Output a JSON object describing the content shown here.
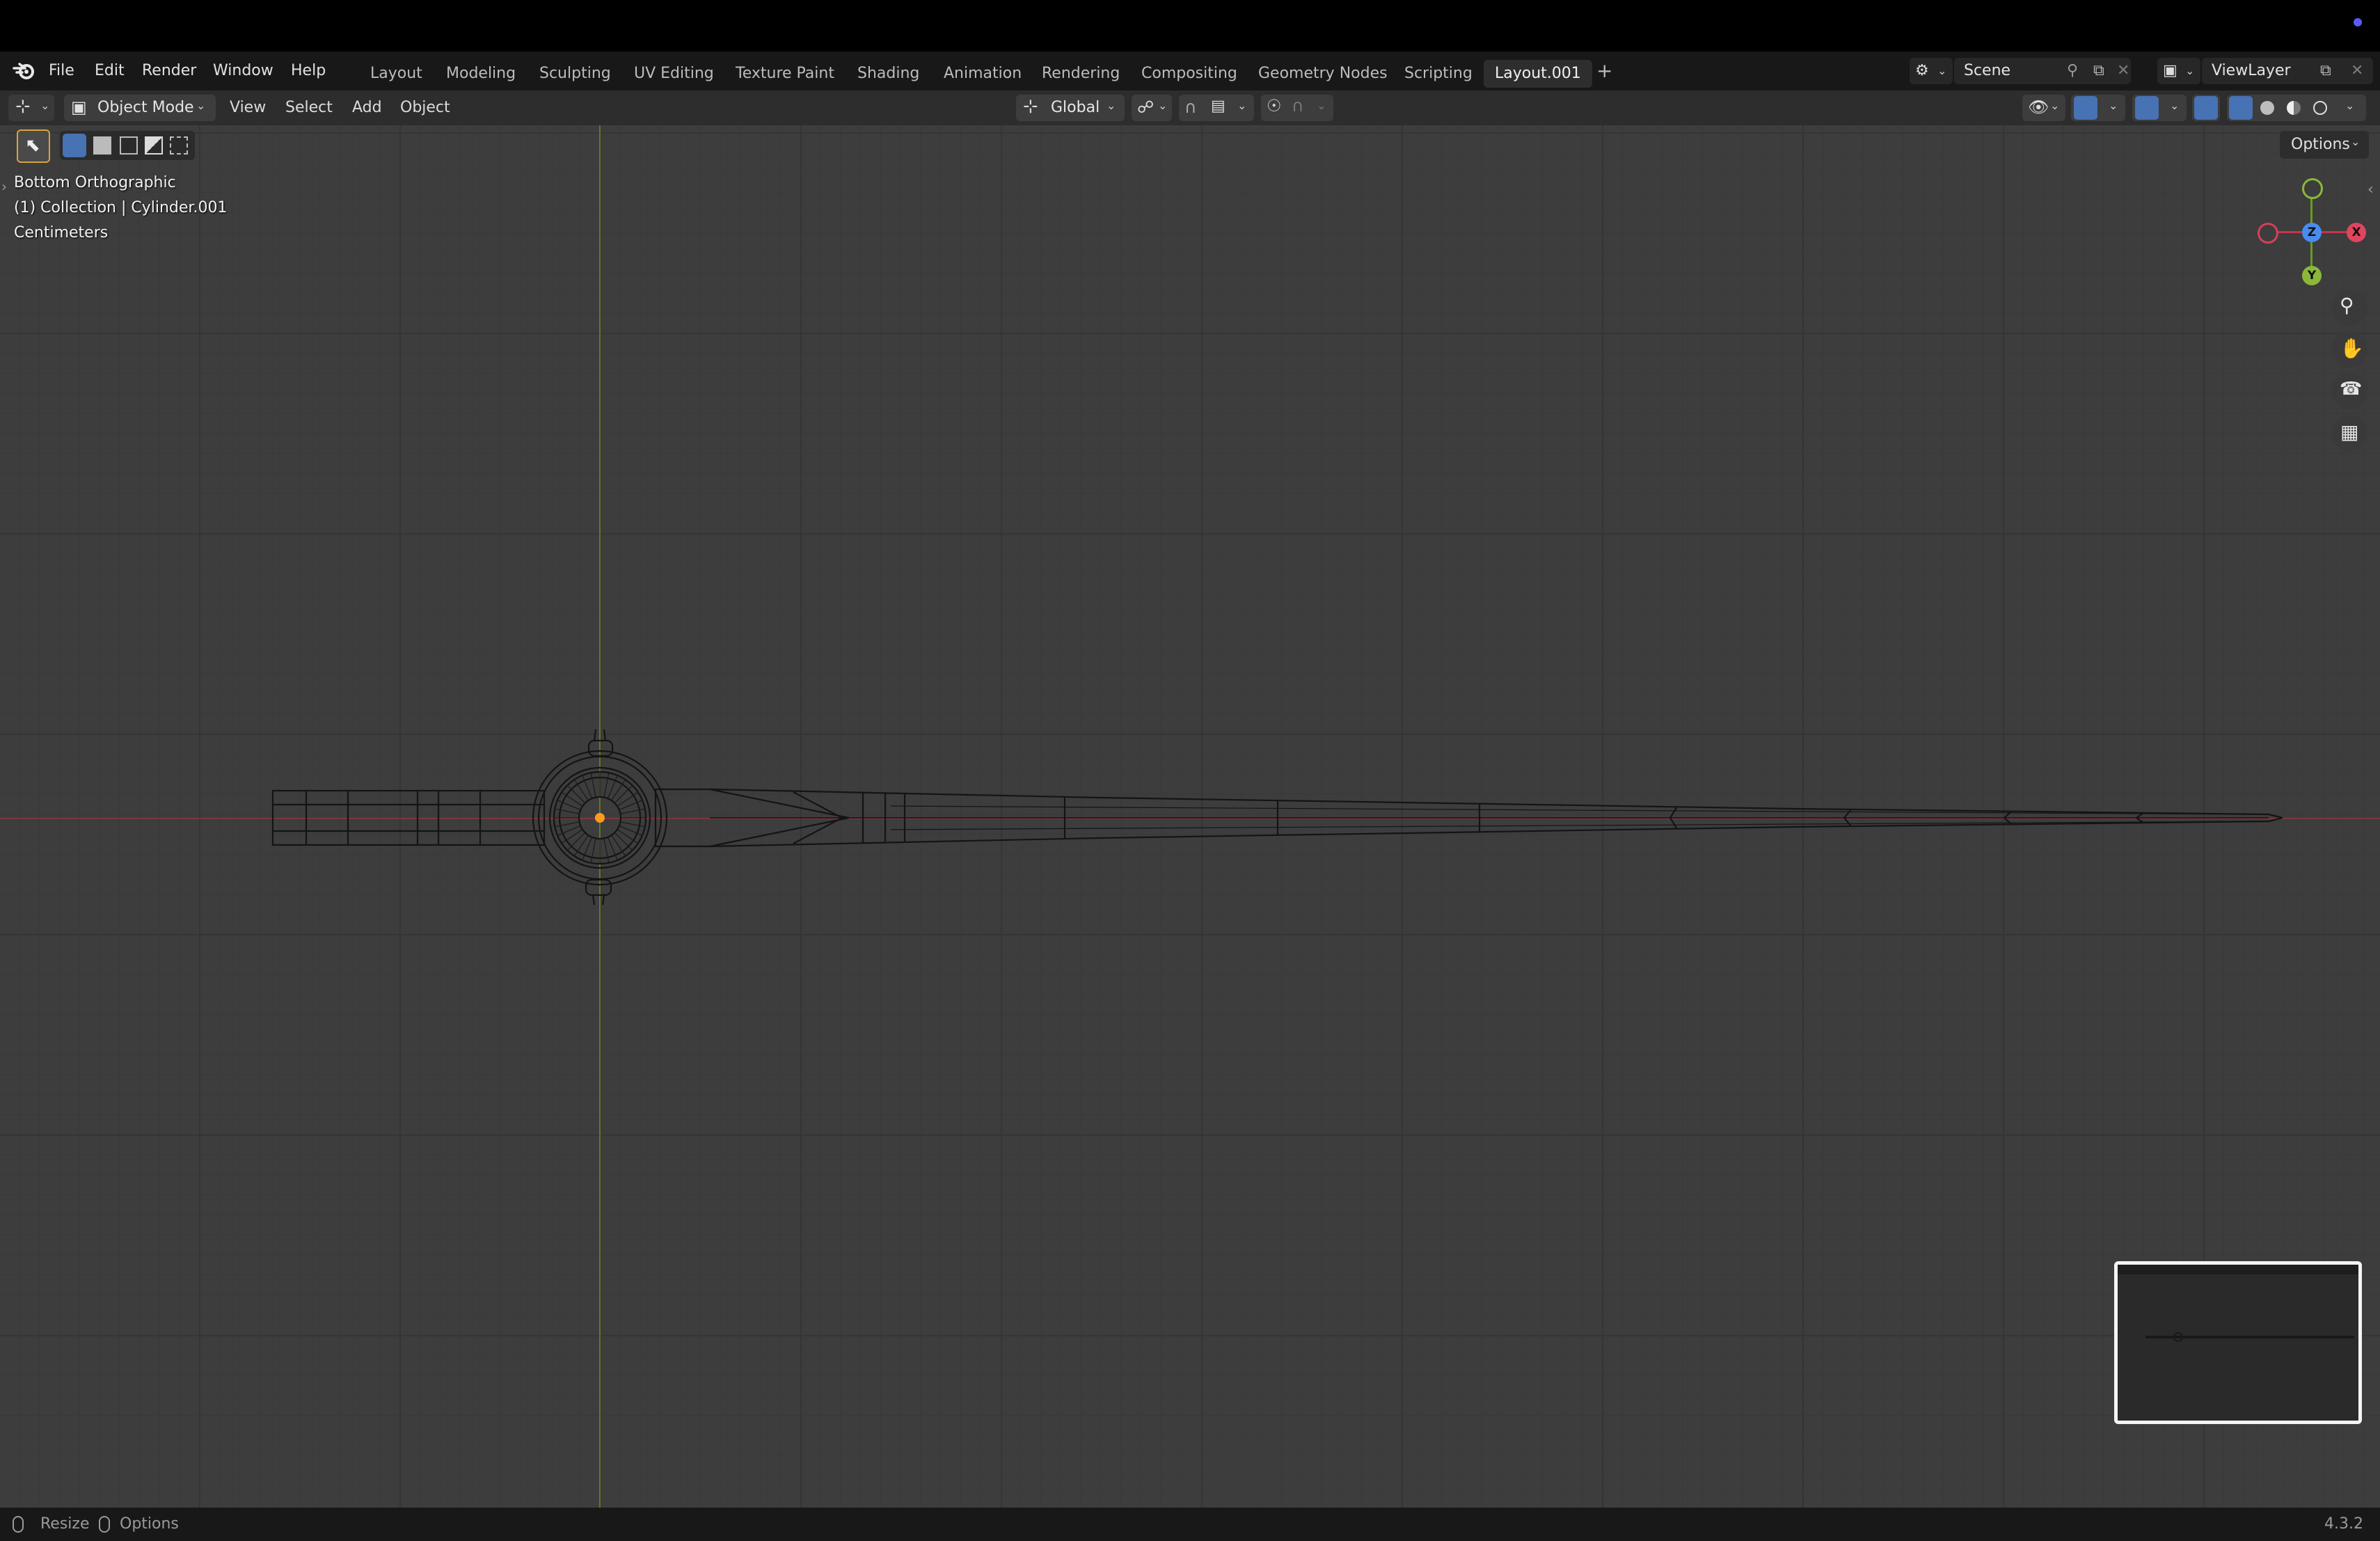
{
  "menubar": {
    "menus": [
      "File",
      "Edit",
      "Render",
      "Window",
      "Help"
    ],
    "workspaces": [
      "Layout",
      "Modeling",
      "Sculpting",
      "UV Editing",
      "Texture Paint",
      "Shading",
      "Animation",
      "Rendering",
      "Compositing",
      "Geometry Nodes",
      "Scripting",
      "Layout.001"
    ],
    "active_workspace": "Layout.001",
    "add_workspace": "+",
    "scene": "Scene",
    "view_layer": "ViewLayer"
  },
  "viewport_header": {
    "mode": "Object Mode",
    "menus": [
      "View",
      "Select",
      "Add",
      "Object"
    ],
    "transform_orientation": "Global",
    "options_label": "Options"
  },
  "viewport": {
    "view_name": "Bottom Orthographic",
    "collection_info": "(1) Collection | Cylinder.001",
    "units": "Centimeters",
    "gizmo_axes": [
      "Z",
      "X",
      "Y"
    ]
  },
  "statusbar": {
    "resize_label": "Resize",
    "options_label": "Options",
    "version": "4.3.2"
  },
  "colors": {
    "x_axis": "#c9334a",
    "y_axis": "#6a9a22",
    "z_axis": "#3a79e0",
    "origin_dot": "#ff9a1f",
    "active_blue": "#4772b3"
  }
}
